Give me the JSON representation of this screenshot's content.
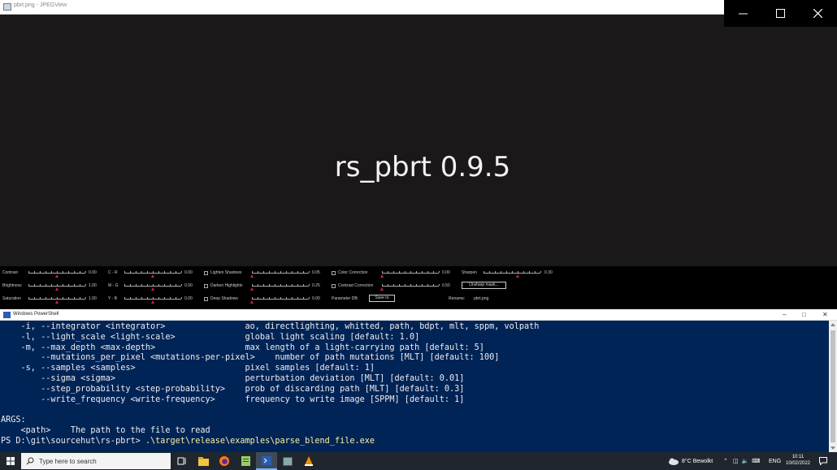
{
  "viewer": {
    "title": "pbrt.png - JPEGView",
    "splash_text": "rs_pbrt 0.9.5",
    "panel": {
      "contrast": {
        "label": "Contrast",
        "value": "0.00",
        "level": 0.5
      },
      "brightness": {
        "label": "Brightness",
        "value": "1.00",
        "level": 0.5
      },
      "saturation": {
        "label": "Saturation",
        "value": "1.00",
        "level": 0.5
      },
      "cr": {
        "label": "C - R",
        "value": "0.00",
        "level": 0.5
      },
      "mg": {
        "label": "M - G",
        "value": "0.00",
        "level": 0.5
      },
      "yb": {
        "label": "Y - B",
        "value": "0.00",
        "level": 0.5
      },
      "lighten_shadows": {
        "label": "Lighten Shadows",
        "value": "0.05",
        "level": 0.0
      },
      "darken_highlights": {
        "label": "Darken Highlights",
        "value": "0.25",
        "level": 0.0
      },
      "deep_shadows": {
        "label": "Deep Shadows",
        "value": "0.00",
        "level": 0.0
      },
      "color_correction": {
        "label": "Color Correction",
        "value": "0.00",
        "level": 0.0
      },
      "contrast_correction": {
        "label": "Contrast Correction",
        "value": "0.50",
        "level": 0.0
      },
      "sharpen": {
        "label": "Sharpen",
        "value": "0.30",
        "level": 0.6
      },
      "unsharp_mask_label": "Unsharp mask...",
      "parameter_db_label": "Parameter DB:",
      "save_to_label": "Save to",
      "rename_label": "Rename:",
      "rename_value": "pbrt.png"
    }
  },
  "powershell": {
    "title": "Windows PowerShell",
    "lines": [
      "    -i, --integrator <integrator>                ao, directlighting, whitted, path, bdpt, mlt, sppm, volpath",
      "    -l, --light_scale <light-scale>              global light scaling [default: 1.0]",
      "    -m, --max_depth <max-depth>                  max length of a light-carrying path [default: 5]",
      "        --mutations_per_pixel <mutations-per-pixel>    number of path mutations [MLT] [default: 100]",
      "    -s, --samples <samples>                      pixel samples [default: 1]",
      "        --sigma <sigma>                          perturbation deviation [MLT] [default: 0.01]",
      "        --step_probability <step-probability>    prob of discarding path [MLT] [default: 0.3]",
      "        --write_frequency <write-frequency>      frequency to write image [SPPM] [default: 1]",
      "",
      "ARGS:",
      "    <path>    The path to the file to read"
    ],
    "prompt": "PS D:\\git\\sourcehut\\rs-pbrt> ",
    "command": ".\\target\\release\\examples\\parse_blend_file.exe"
  },
  "taskbar": {
    "search_placeholder": "Type here to search",
    "weather": "8°C  Bewolkt",
    "language": "ENG",
    "time": "10:11",
    "date": "10/02/2022"
  }
}
